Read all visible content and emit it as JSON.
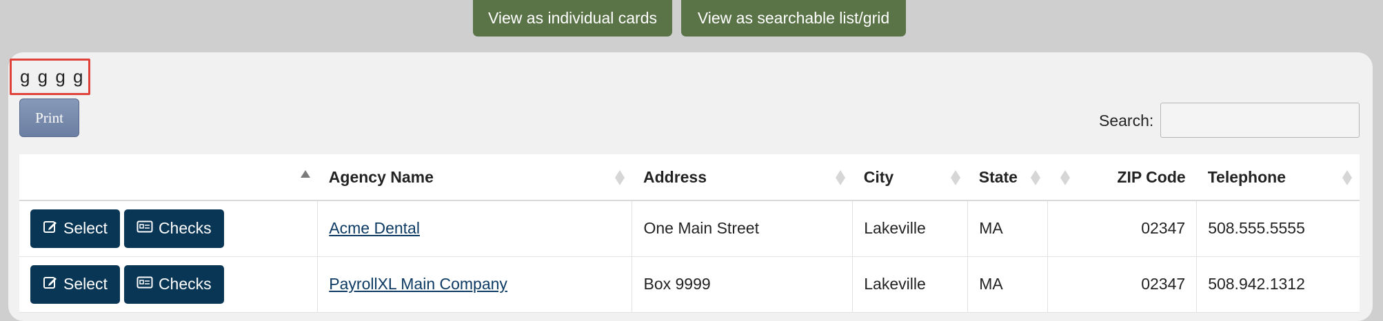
{
  "view_buttons": {
    "cards": "View as individual cards",
    "list": "View as searchable list/grid"
  },
  "page_title": "g g g g",
  "print_label": "Print",
  "search": {
    "label": "Search:",
    "value": ""
  },
  "table": {
    "headers": [
      "",
      "Agency Name",
      "Address",
      "City",
      "State",
      "",
      "ZIP Code",
      "Telephone"
    ],
    "rows": [
      {
        "select": "Select",
        "checks": "Checks",
        "agency": "Acme Dental",
        "address": "One Main Street",
        "city": "Lakeville",
        "state": "MA",
        "zip": "02347",
        "phone": "508.555.5555"
      },
      {
        "select": "Select",
        "checks": "Checks",
        "agency": "PayrollXL Main Company",
        "address": "Box 9999",
        "city": "Lakeville",
        "state": "MA",
        "zip": "02347",
        "phone": "508.942.1312"
      }
    ]
  },
  "colors": {
    "green": "#5a7448",
    "navy": "#0a3656",
    "highlight": "#e0423a"
  },
  "icons": {
    "select": "edit-icon",
    "checks": "id-card-icon",
    "sort": "sort-icon"
  }
}
